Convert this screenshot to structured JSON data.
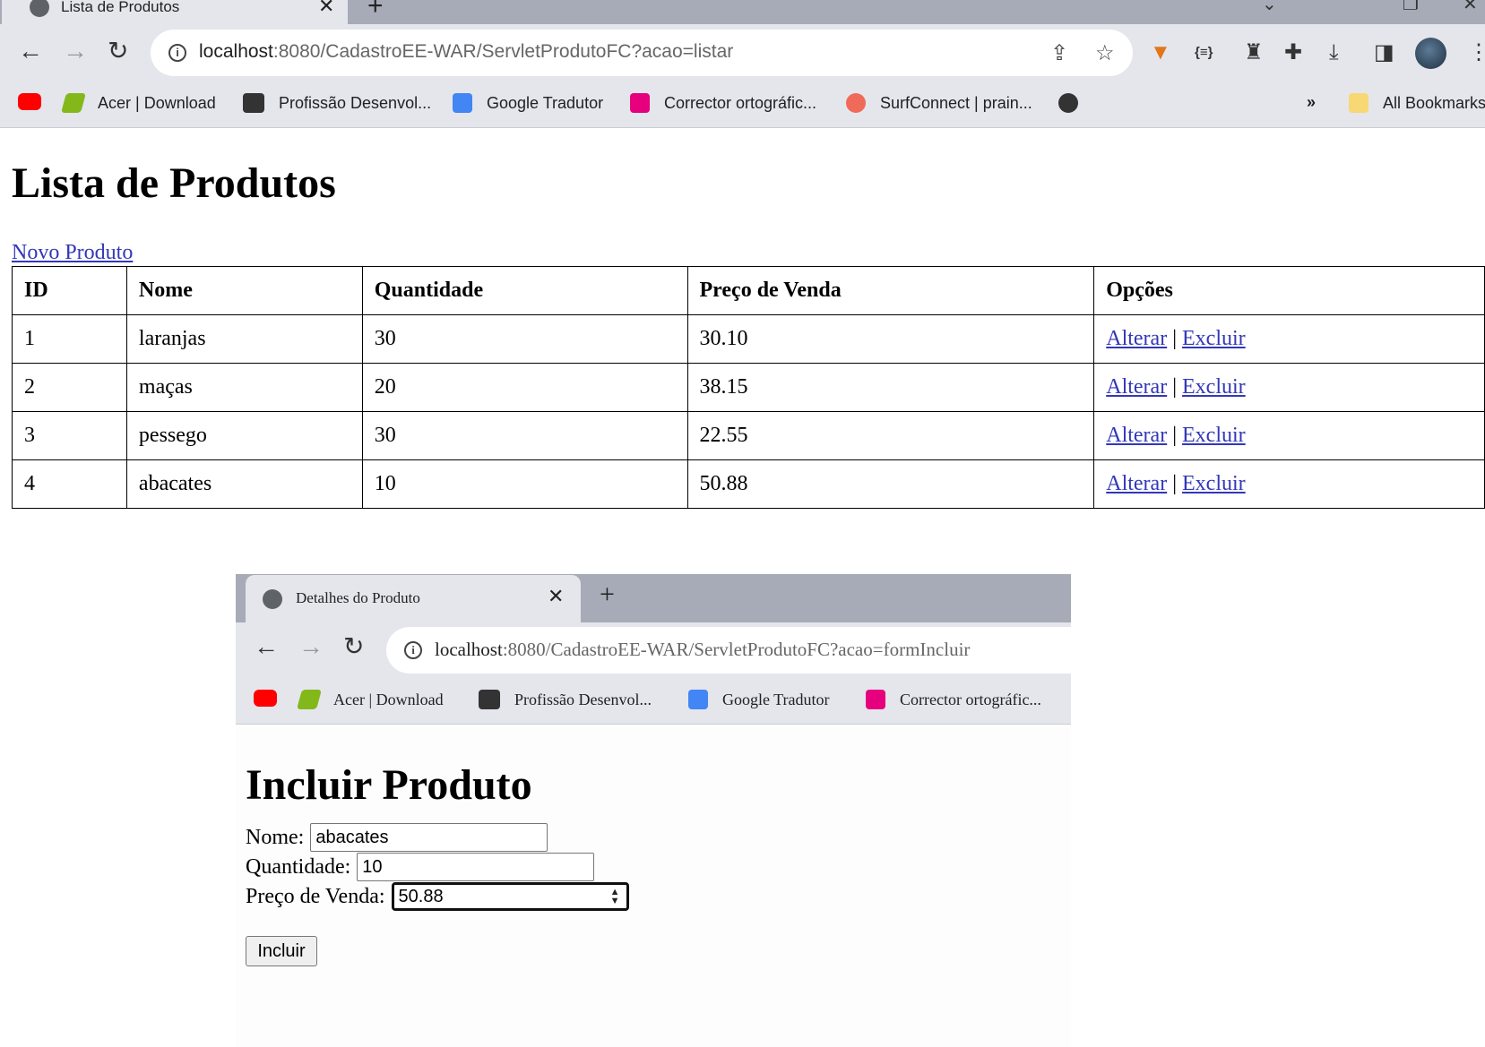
{
  "browser": {
    "tab_title": "Lista de Produtos",
    "url_host": "localhost",
    "url_rest": ":8080/CadastroEE-WAR/ServletProdutoFC?acao=listar",
    "bookmarks": [
      "Acer | Download",
      "Profissão Desenvol...",
      "Google Tradutor",
      "Corrector ortográfic...",
      "SurfConnect | prain..."
    ],
    "more_label": "»",
    "all_bookmarks": "All Bookmarks",
    "extensions_icon_label": "{≡}",
    "icons": [
      "back-arrow-icon",
      "forward-arrow-icon",
      "reload-icon",
      "site-info-icon",
      "share-icon",
      "star-icon",
      "metamask-fox-icon",
      "json-viewer-icon",
      "robot-icon",
      "puzzle-icon",
      "download-icon",
      "side-panel-icon",
      "profile-avatar",
      "more-icon",
      "folder-icon"
    ],
    "colors": {
      "tabstrip": "#a7abb7",
      "toolbar": "#e4e6ec",
      "link": "#3237b8"
    }
  },
  "page": {
    "title": "Lista de Produtos",
    "new_product_link": "Novo Produto",
    "table": {
      "headers": [
        "ID",
        "Nome",
        "Quantidade",
        "Preço de Venda",
        "Opções"
      ],
      "rows": [
        {
          "id": "1",
          "nome": "laranjas",
          "quantidade": "30",
          "preco": "30.10"
        },
        {
          "id": "2",
          "nome": "maças",
          "quantidade": "20",
          "preco": "38.15"
        },
        {
          "id": "3",
          "nome": "pessego",
          "quantidade": "30",
          "preco": "22.55"
        },
        {
          "id": "4",
          "nome": "abacates",
          "quantidade": "10",
          "preco": "50.88"
        }
      ],
      "alter_label": "Alterar",
      "separator": "|",
      "delete_label": "Excluir"
    }
  },
  "inset": {
    "tab_title": "Detalhes do Produto",
    "url_host": "localhost",
    "url_rest": ":8080/CadastroEE-WAR/ServletProdutoFC?acao=formIncluir",
    "bookmarks": [
      "Acer | Download",
      "Profissão Desenvol...",
      "Google Tradutor",
      "Corrector ortográfic..."
    ],
    "form_title": "Incluir Produto",
    "fields": {
      "nome_label": "Nome:",
      "nome_value": "abacates",
      "quantidade_label": "Quantidade:",
      "quantidade_value": "10",
      "preco_label": "Preço de Venda:",
      "preco_value": "50.88"
    },
    "submit_label": "Incluir"
  }
}
